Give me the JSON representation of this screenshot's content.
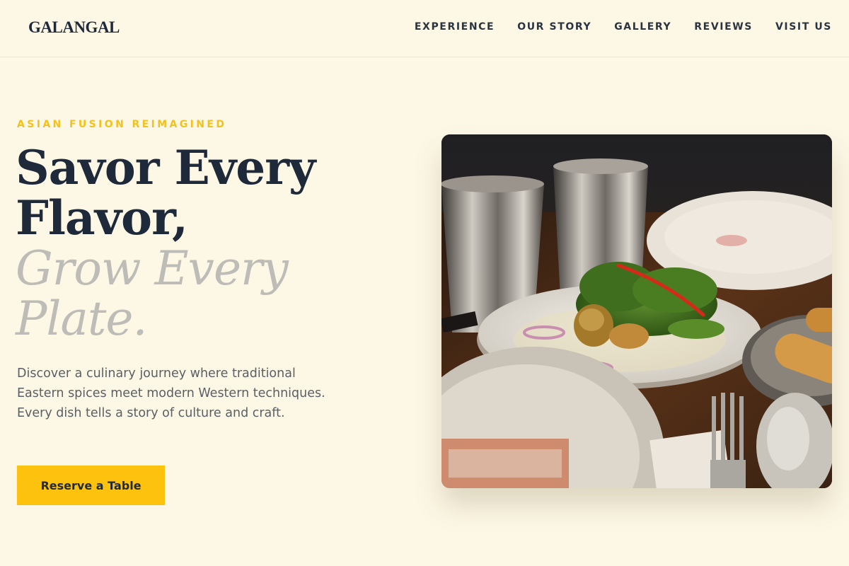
{
  "header": {
    "logo": "GALANGAL",
    "nav": [
      "EXPERIENCE",
      "OUR STORY",
      "GALLERY",
      "REVIEWS",
      "VISIT US"
    ]
  },
  "hero": {
    "eyebrow": "ASIAN FUSION REIMAGINED",
    "headline_line1": "Savor Every",
    "headline_line2": "Flavor,",
    "headline_line3": "Grow Every",
    "headline_line4": "Plate.",
    "description": "Discover a culinary journey where traditional Eastern spices meet modern Western techniques. Every dish tells a story of culture and craft.",
    "cta_label": "Reserve a Table"
  },
  "colors": {
    "background": "#fdf8e6",
    "accent": "#fdc20d",
    "eyebrow": "#f3c11b",
    "heading": "#1e2a3a",
    "muted_heading": "#bebcb6"
  }
}
